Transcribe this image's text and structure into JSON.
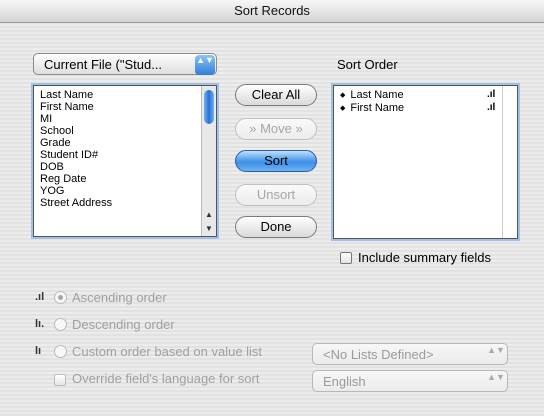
{
  "window": {
    "title": "Sort Records"
  },
  "file_popup": {
    "value": "Current File (\"Stud...",
    "arrows": "▲▼"
  },
  "fields_list": {
    "items": [
      "Last Name",
      "First Name",
      "MI",
      "School",
      "Grade",
      "Student ID#",
      "DOB",
      "Reg Date",
      "YOG",
      "Street Address"
    ],
    "scroll_up_glyph": "▲",
    "scroll_down_glyph": "▼"
  },
  "sort_order": {
    "label": "Sort Order",
    "items": [
      {
        "name": "Last Name",
        "updown": "◆",
        "order_icon": ".ıl"
      },
      {
        "name": "First Name",
        "updown": "◆",
        "order_icon": ".ıl"
      }
    ]
  },
  "buttons": {
    "clear_all": "Clear All",
    "move": "» Move »",
    "sort": "Sort",
    "unsort": "Unsort",
    "done": "Done"
  },
  "include_summary": "Include summary fields",
  "order_options": {
    "ascending": {
      "label": "Ascending order",
      "icon": ".ıl"
    },
    "descending": {
      "label": "Descending order",
      "icon": "lı."
    },
    "custom": {
      "label": "Custom order based on value list",
      "icon": "lı"
    }
  },
  "value_list_popup": {
    "value": "<No Lists Defined>",
    "arrows": "▲▼"
  },
  "override_language": {
    "label": "Override field's language for sort"
  },
  "language_popup": {
    "value": "English",
    "arrows": "▲▼"
  }
}
